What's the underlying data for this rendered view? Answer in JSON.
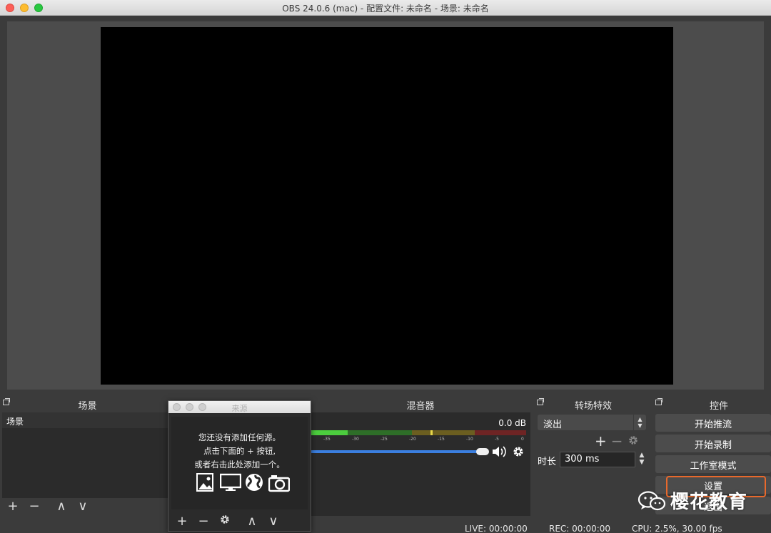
{
  "window": {
    "title": "OBS 24.0.6 (mac) - 配置文件: 未命名 - 场景: 未命名"
  },
  "docks": {
    "scenes": {
      "title": "场景",
      "items": [
        "场景"
      ]
    },
    "mixer": {
      "title": "混音器",
      "db_value": "0.0 dB",
      "ticks": [
        "-35",
        "-30",
        "-25",
        "-20",
        "-15",
        "-10",
        "-5",
        "0"
      ]
    },
    "transitions": {
      "title": "转场特效",
      "selected": "淡出",
      "duration_label": "时长",
      "duration_value": "300 ms"
    },
    "controls": {
      "title": "控件",
      "start_streaming": "开始推流",
      "start_recording": "开始录制",
      "studio_mode": "工作室模式",
      "settings": "设置",
      "exit": "退出"
    }
  },
  "sources": {
    "title": "来源",
    "hint_line1": "您还没有添加任何源。",
    "hint_line2": "点击下面的 + 按钮,",
    "hint_line3": "或者右击此处添加一个。",
    "icons": [
      "image-icon",
      "display-icon",
      "globe-icon",
      "camera-icon"
    ]
  },
  "toolbar_glyphs": {
    "add": "+",
    "remove": "−",
    "up": "∧",
    "down": "∨"
  },
  "watermark": {
    "text": "樱花教育"
  },
  "status": {
    "live": "LIVE: 00:00:00",
    "rec": "REC: 00:00:00",
    "cpu": "CPU: 2.5%, 30.00 fps"
  },
  "colors": {
    "accent_blue": "#3b7fe0",
    "highlight_orange": "#e8692c",
    "meter_green": "#4ccd3e",
    "meter_yellow": "#c9b53a",
    "meter_red": "#b83a3a"
  }
}
